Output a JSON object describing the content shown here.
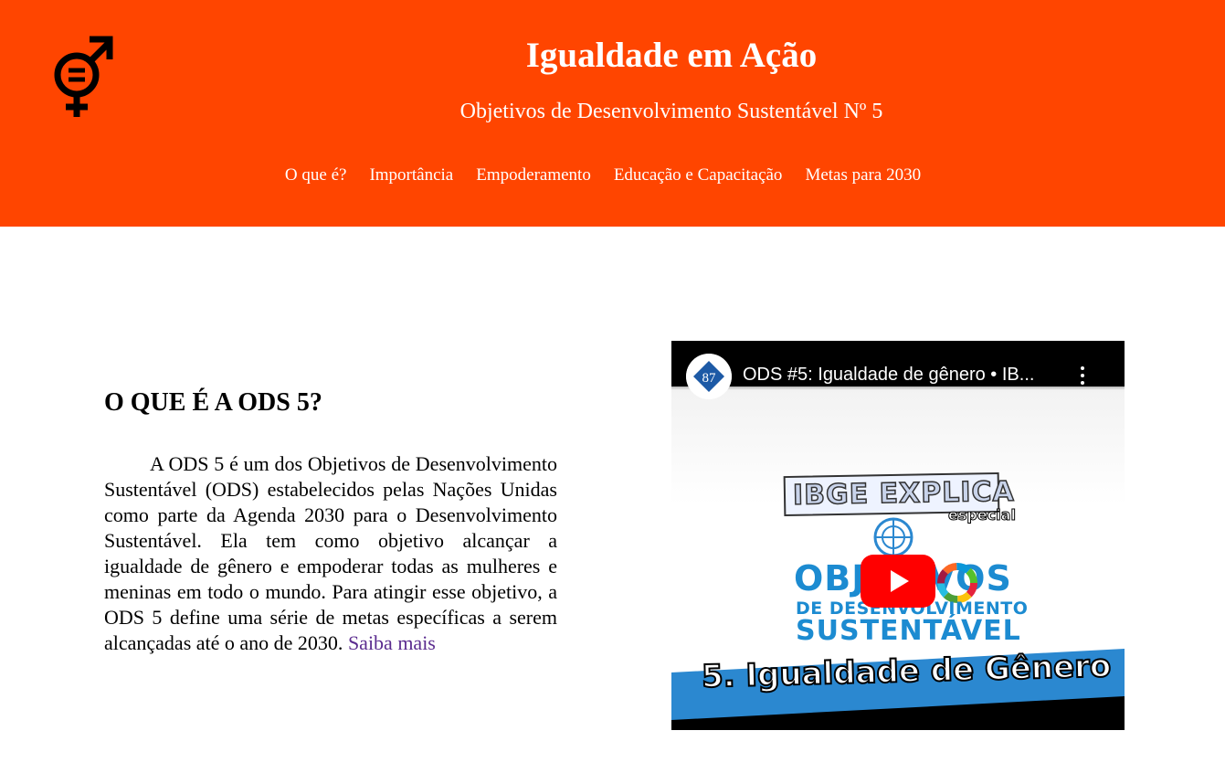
{
  "header": {
    "title": "Igualdade em Ação",
    "subtitle": "Objetivos de Desenvolvimento Sustentável Nº 5",
    "background_color": "#ff4500",
    "logo_icon": "gender-equality-icon"
  },
  "nav": {
    "items": [
      {
        "label": "O que é?"
      },
      {
        "label": "Importância"
      },
      {
        "label": "Empoderamento"
      },
      {
        "label": "Educação e Capacitação"
      },
      {
        "label": "Metas para 2030"
      }
    ]
  },
  "main": {
    "section_title": "O QUE É A ODS 5?",
    "paragraph": "A ODS 5 é um dos Objetivos de Desenvolvimento Sustentável (ODS) estabelecidos pelas Nações Unidas como parte da Agenda 2030 para o Desenvolvimento Sustentável. Ela tem como objetivo alcançar a igualdade de gênero e empoderar todas as mulheres e meninas em todo o mundo. Para atingir esse objetivo, a ODS 5 define uma série de metas específicas a serem alcançadas até o ano de 2030.",
    "link_label": "Saiba mais",
    "link_color": "#5b2c8f"
  },
  "video": {
    "title": "ODS #5: Igualdade de gênero • IB...",
    "channel_badge": "87",
    "thumbnail": {
      "banner": "IBGE EXPLICA",
      "banner_tag": "especial",
      "line1": "OBJETIVOS",
      "line2": "DE DESENVOLVIMENTO",
      "line3": "SUSTENTÁVEL",
      "goal": "5. Igualdade de Gênero",
      "accent_color": "#1c8bd1"
    },
    "play_color": "#ff0000"
  }
}
